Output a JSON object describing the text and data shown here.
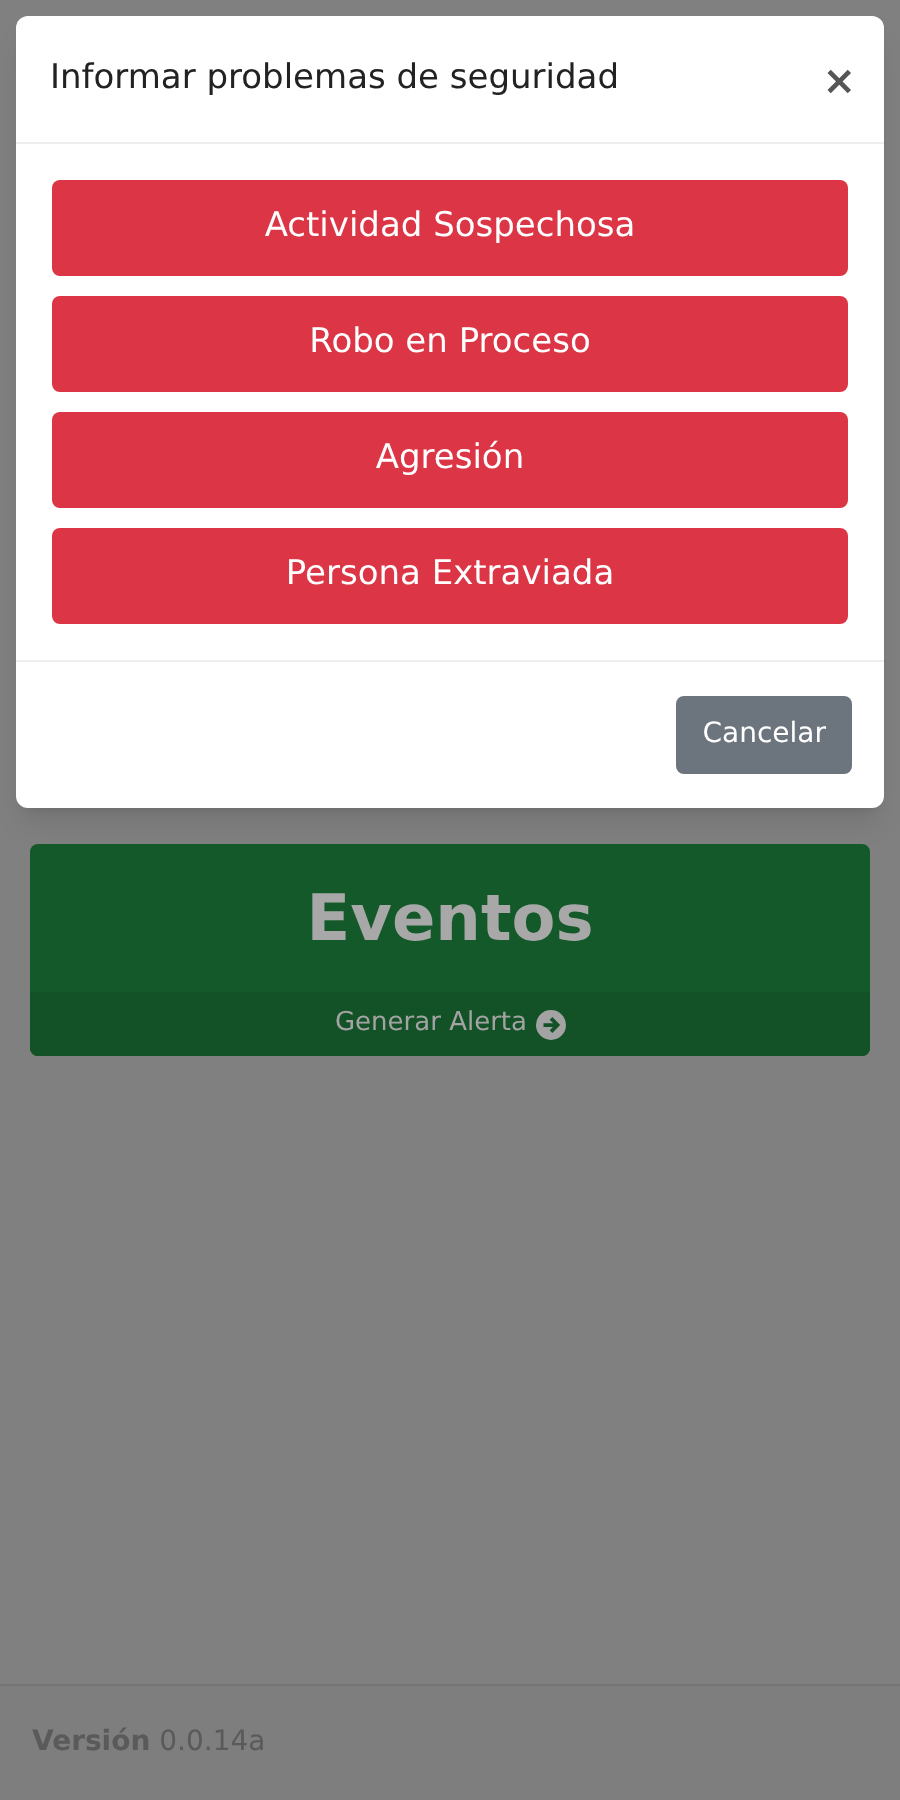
{
  "modal": {
    "title": "Informar problemas de seguridad",
    "close": "×",
    "options": [
      "Actividad Sospechosa",
      "Robo en Proceso",
      "Agresión",
      "Persona Extraviada"
    ],
    "cancel": "Cancelar"
  },
  "card": {
    "title": "Eventos",
    "link": "Generar Alerta"
  },
  "footer": {
    "version": "**Versión** 0.0.14a"
  }
}
